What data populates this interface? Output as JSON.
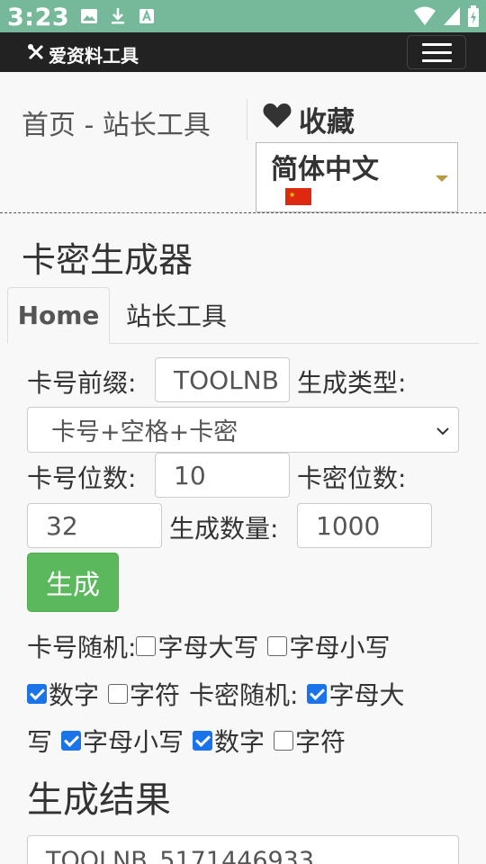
{
  "status_bar": {
    "time": "3:23"
  },
  "app": {
    "logo_text": "爱资料工具"
  },
  "header": {
    "breadcrumb": "首页 - 站长工具",
    "favorite_label": "收藏",
    "language": "简体中文"
  },
  "page": {
    "title": "卡密生成器"
  },
  "tabs": [
    {
      "label": "Home"
    },
    {
      "label": "站长工具"
    }
  ],
  "form": {
    "prefix_label": "卡号前缀:",
    "prefix_value": "TOOLNB",
    "type_label": "生成类型:",
    "type_value": "卡号+空格+卡密",
    "card_len_label": "卡号位数:",
    "card_len_value": "10",
    "pass_len_label": "卡密位数:",
    "pass_len_value": "32",
    "count_label": "生成数量:",
    "count_value": "1000",
    "generate_button": "生成"
  },
  "options": {
    "card_random_label": "卡号随机:",
    "pass_random_label": "卡密随机:",
    "uppercase": "字母大写",
    "uppercase_wrap1": "字母大",
    "uppercase_wrap2": "写",
    "lowercase": "字母小写",
    "digits": "数字",
    "symbols": "字符",
    "card_random": {
      "uppercase": false,
      "lowercase": false,
      "digits": true,
      "symbols": false
    },
    "pass_random": {
      "uppercase": true,
      "lowercase": true,
      "digits": true,
      "symbols": false
    }
  },
  "result": {
    "title": "生成结果",
    "first_line": "TOOLNB_5171446933"
  },
  "colors": {
    "status_bar": "#76b99a",
    "app_bar": "#222222",
    "generate_button": "#5cb85c",
    "checkbox_checked": "#1a73e8"
  }
}
